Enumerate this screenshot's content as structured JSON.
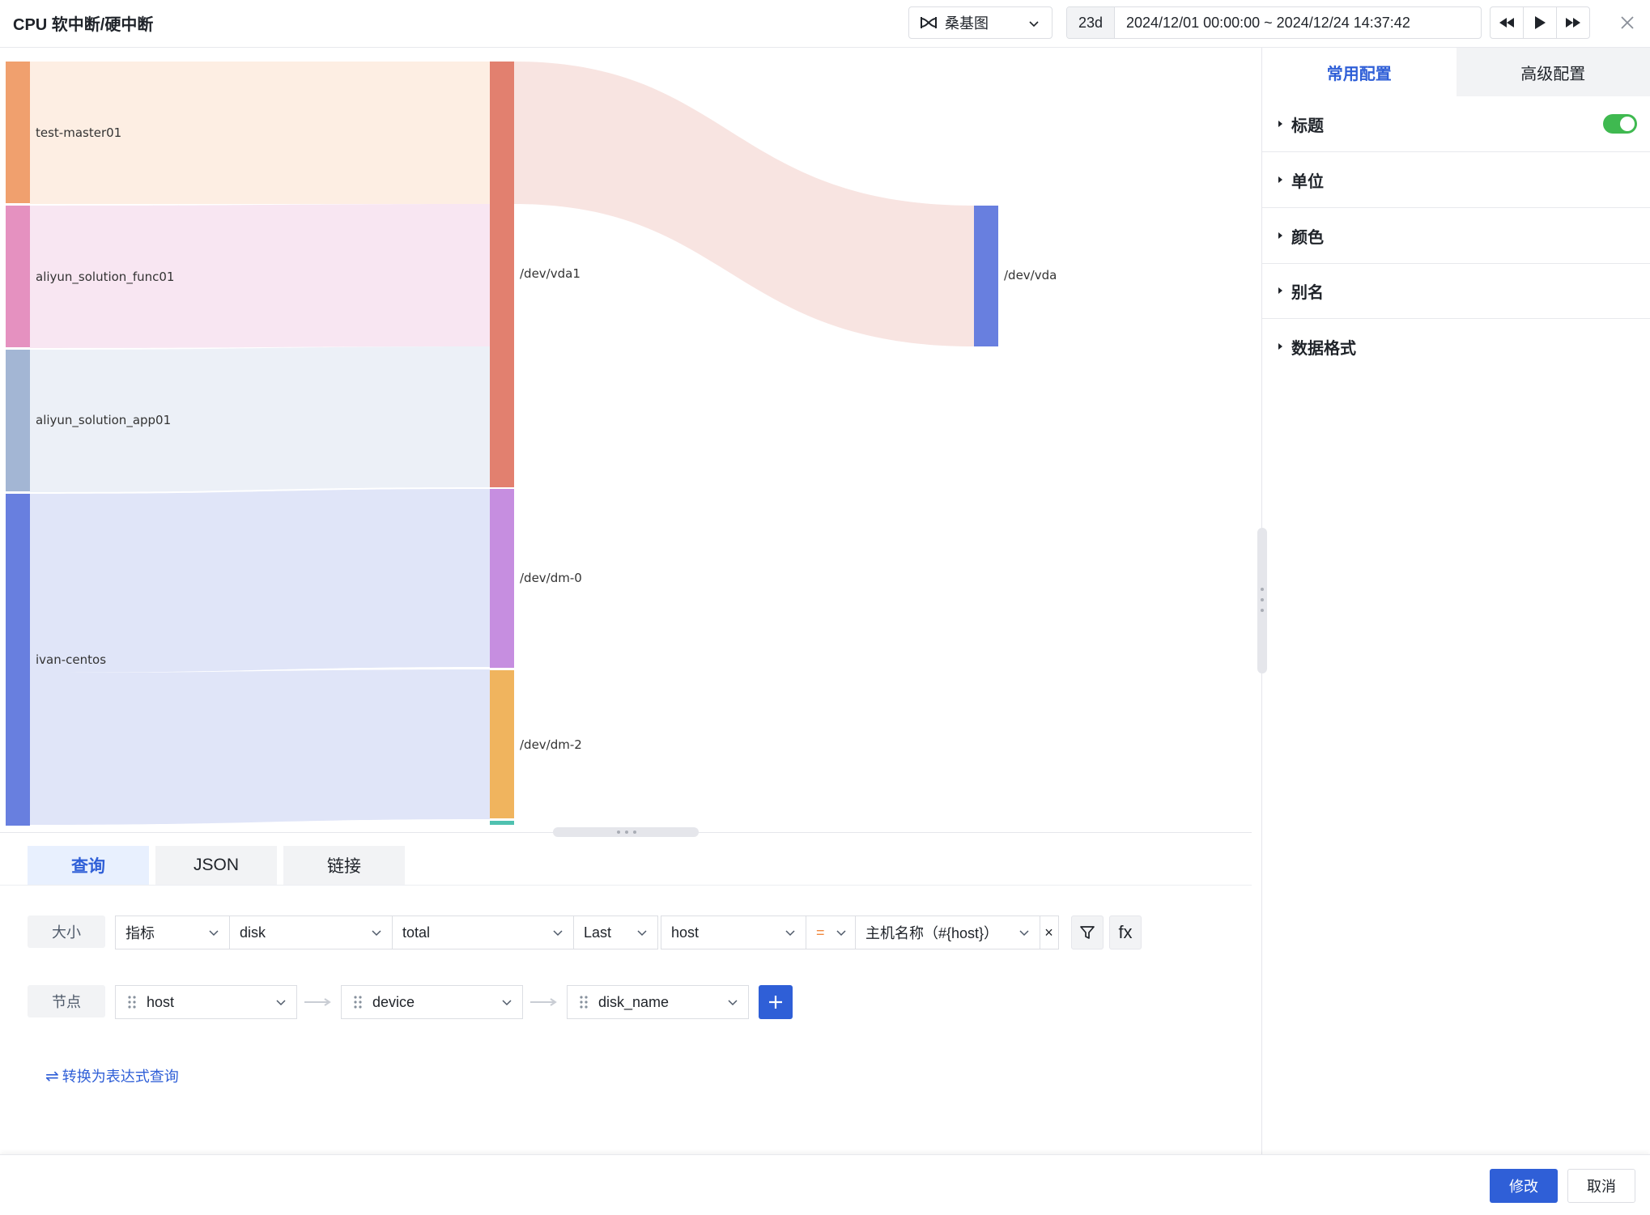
{
  "header": {
    "title": "CPU 软中断/硬中断",
    "chart_type": "桑基图",
    "relative_range": "23d",
    "time_range": "2024/12/01 00:00:00 ~ 2024/12/24 14:37:42"
  },
  "sankey": {
    "nodes": [
      {
        "id": "test-master01",
        "label": "test-master01",
        "color": "#f0a06e",
        "column": 0
      },
      {
        "id": "aliyun_solution_func01",
        "label": "aliyun_solution_func01",
        "color": "#e591c0",
        "column": 0
      },
      {
        "id": "aliyun_solution_app01",
        "label": "aliyun_solution_app01",
        "color": "#a3b6d4",
        "column": 0
      },
      {
        "id": "ivan-centos",
        "label": "ivan-centos",
        "color": "#687fdf",
        "column": 0
      },
      {
        "id": "/dev/vda1",
        "label": "/dev/vda1",
        "color": "#e2806f",
        "column": 1
      },
      {
        "id": "/dev/dm-0",
        "label": "/dev/dm-0",
        "color": "#c68ee0",
        "column": 1
      },
      {
        "id": "/dev/dm-2",
        "label": "/dev/dm-2",
        "color": "#f0b45e",
        "column": 1
      },
      {
        "id": "/dev/vda",
        "label": "/dev/vda",
        "color": "#687fdf",
        "column": 2
      }
    ],
    "link_colors": {
      "test-master01": "#fdeee3",
      "aliyun_solution_func01": "#f8e6f2",
      "aliyun_solution_app01": "#ecf0f7",
      "ivan-centos": "#e0e5f8",
      "/dev/vda1": "#f8e4e1"
    }
  },
  "query": {
    "tabs": [
      "查询",
      "JSON",
      "链接"
    ],
    "active_tab": "查询",
    "size_row": {
      "label": "大小",
      "metric_type": "指标",
      "measurement": "disk",
      "field": "total",
      "aggregate": "Last",
      "tag_key": "host",
      "operator": "=",
      "tag_value": "主机名称（#{host}）",
      "clear": "×",
      "fx": "fx"
    },
    "node_row": {
      "label": "节点",
      "nodes": [
        "host",
        "device",
        "disk_name"
      ]
    },
    "convert_link": "转换为表达式查询"
  },
  "settings": {
    "tabs": [
      "常用配置",
      "高级配置"
    ],
    "active_tab": "常用配置",
    "sections": [
      "标题",
      "单位",
      "颜色",
      "别名",
      "数据格式"
    ],
    "title_toggle_on": true
  },
  "footer": {
    "confirm": "修改",
    "cancel": "取消"
  },
  "colors": {
    "primary": "#2f5fd7",
    "toggle_on": "#3fb950"
  }
}
